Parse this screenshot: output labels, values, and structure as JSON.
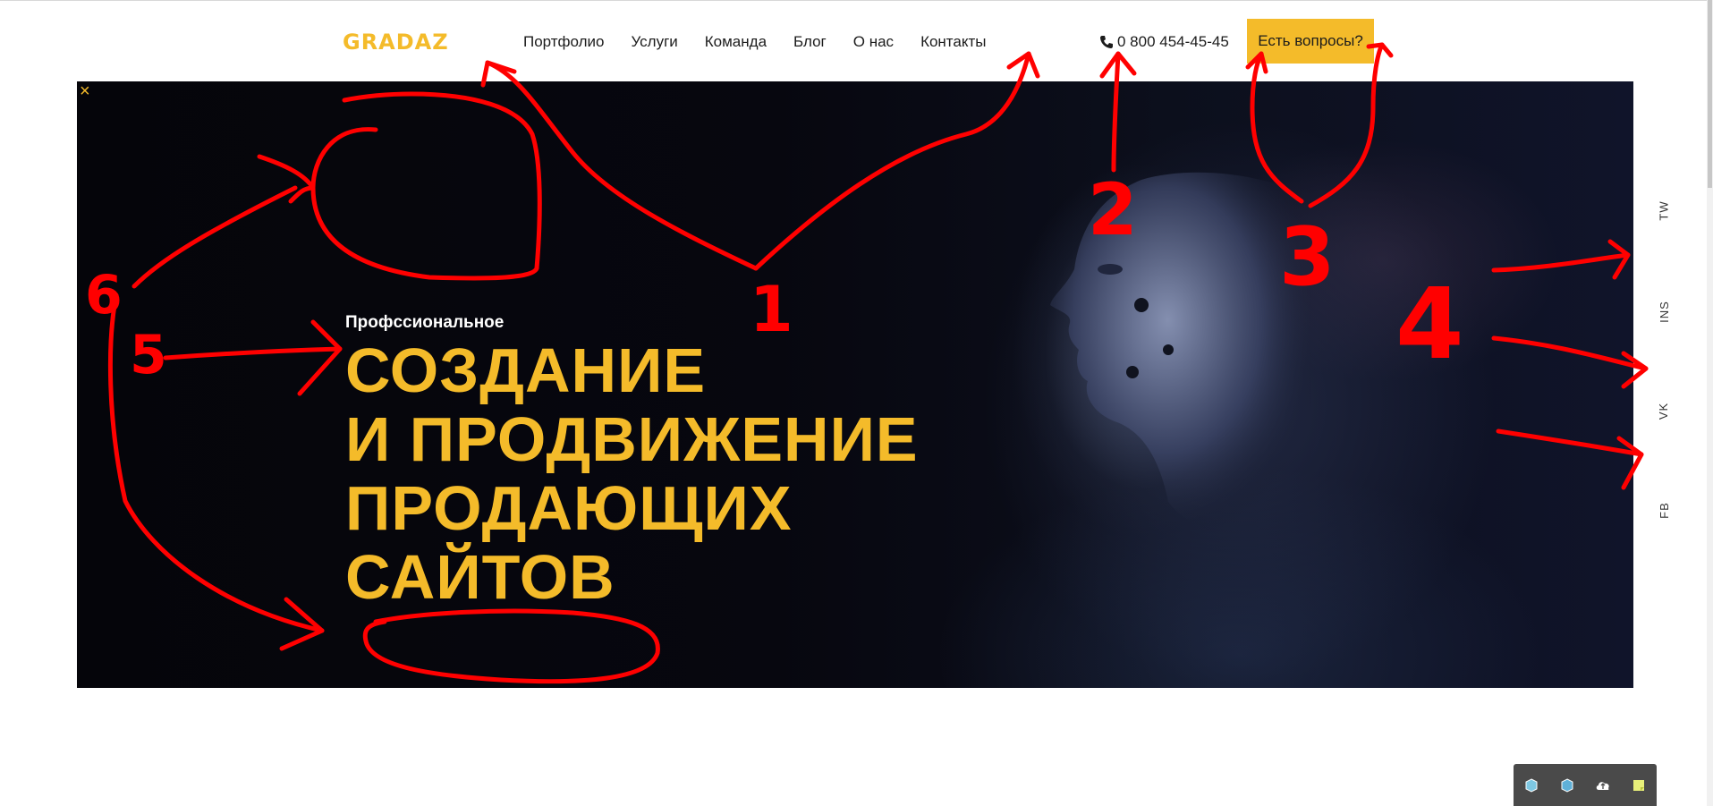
{
  "header": {
    "logo": "GRADAZ",
    "nav": [
      "Портфолио",
      "Услуги",
      "Команда",
      "Блог",
      "О нас",
      "Контакты"
    ],
    "phone": "0 800 454-45-45",
    "cta": "Есть вопросы?"
  },
  "hero": {
    "close_mark": "×",
    "eyebrow": "Профссиональное",
    "headline_lines": [
      "СОЗДАНИЕ",
      "И ПРОДВИЖЕНИЕ",
      "ПРОДАЮЩИХ",
      "САЙТОВ"
    ]
  },
  "social": [
    "TW",
    "INS",
    "VK",
    "FB"
  ],
  "annotations": [
    "1",
    "2",
    "3",
    "4",
    "5",
    "6"
  ],
  "colors": {
    "accent": "#f4bb2a",
    "annotation": "#ff0000",
    "hero_bg": "#07070d"
  },
  "icons": {
    "phone": "phone-icon",
    "toolbar": [
      "cube-icon",
      "cube-alt-icon",
      "cloud-upload-icon",
      "note-icon"
    ]
  }
}
